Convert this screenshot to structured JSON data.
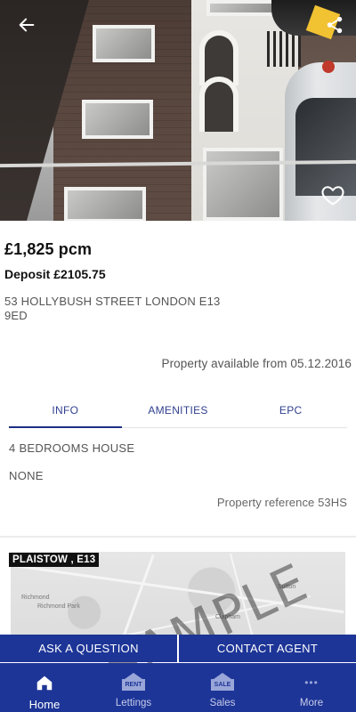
{
  "listing": {
    "price": "£1,825 pcm",
    "deposit": "Deposit £2105.75",
    "address": "53 HOLLYBUSH STREET LONDON E13 9ED",
    "available": "Property available from 05.12.2016"
  },
  "tabs": [
    {
      "label": "INFO",
      "active": true
    },
    {
      "label": "AMENITIES",
      "active": false
    },
    {
      "label": "EPC",
      "active": false
    }
  ],
  "info": {
    "type": "4 BEDROOMS HOUSE",
    "extra": "NONE",
    "reference": "Property reference 53HS"
  },
  "map": {
    "area_tag": "PLAISTOW , E13",
    "watermark": "SAMPLE",
    "labels": [
      "Richmond",
      "Richmond Park",
      "Sutton",
      "Clapham"
    ]
  },
  "actions": {
    "ask": "ASK A QUESTION",
    "contact": "CONTACT AGENT"
  },
  "nav": {
    "home": "Home",
    "lettings": "Lettings",
    "lettings_badge": "RENT",
    "sales": "Sales",
    "sales_badge": "SALE",
    "more": "More",
    "more_glyph": "•••"
  },
  "icons": {
    "back": "arrow-left-icon",
    "share": "share-icon",
    "favorite": "heart-outline-icon",
    "home": "home-icon",
    "lettings": "rent-sign-icon",
    "sales": "sale-sign-icon",
    "more": "more-dots-icon"
  },
  "colors": {
    "brand_blue": "#1d3597",
    "tab_text": "#2f3f8f",
    "price_text": "#111111"
  }
}
